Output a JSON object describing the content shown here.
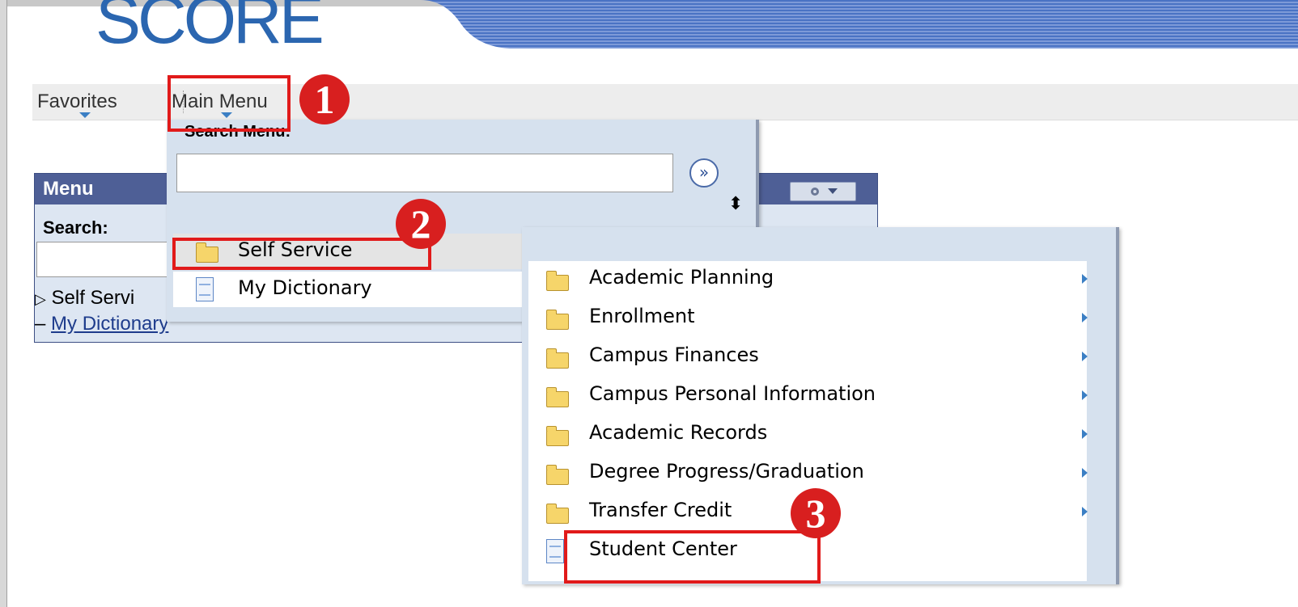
{
  "logo": {
    "text": "SCORE"
  },
  "nav": {
    "favorites": "Favorites",
    "main_menu": "Main Menu"
  },
  "menu_panel": {
    "title": "Menu",
    "search_label": "Search:",
    "tree": [
      {
        "label": "Self Servi",
        "marker": "▷"
      },
      {
        "label": "My Dictionary",
        "marker": "–"
      }
    ]
  },
  "dropdown": {
    "search_label": "Search Menu:",
    "search_value": "",
    "go_symbol": "»",
    "sort_symbol": "⬍",
    "items": [
      {
        "label": "Self Service",
        "icon": "folder-icon"
      },
      {
        "label": "My Dictionary",
        "icon": "document-icon"
      }
    ]
  },
  "submenu": {
    "items": [
      {
        "label": "Academic Planning",
        "icon": "folder-icon",
        "has_children": true
      },
      {
        "label": "Enrollment",
        "icon": "folder-icon",
        "has_children": true
      },
      {
        "label": "Campus Finances",
        "icon": "folder-icon",
        "has_children": true
      },
      {
        "label": "Campus Personal Information",
        "icon": "folder-icon",
        "has_children": true
      },
      {
        "label": "Academic Records",
        "icon": "folder-icon",
        "has_children": true
      },
      {
        "label": "Degree Progress/Graduation",
        "icon": "folder-icon",
        "has_children": true
      },
      {
        "label": "Transfer Credit",
        "icon": "folder-icon",
        "has_children": true
      },
      {
        "label": "Student Center",
        "icon": "document-icon",
        "has_children": false
      }
    ]
  },
  "annotations": {
    "step1": "1",
    "step2": "2",
    "step3": "3"
  },
  "colors": {
    "highlight": "#e11a1a",
    "badge": "#d81f1f",
    "brand": "#2b66b0",
    "menu_header": "#4e5f96"
  }
}
